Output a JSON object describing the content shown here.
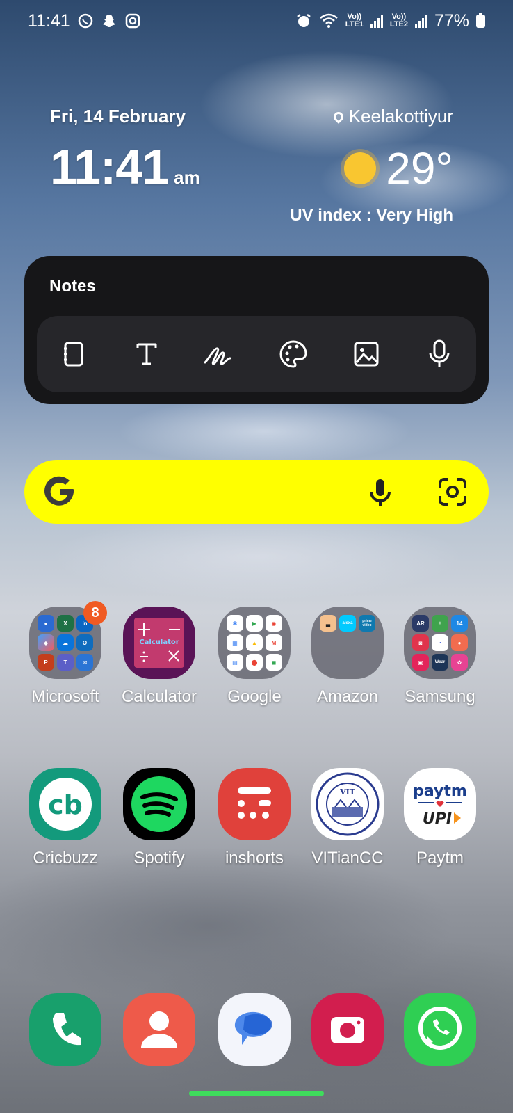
{
  "status_bar": {
    "time": "11:41",
    "left_icons": [
      "whatsapp-icon",
      "snapchat-icon",
      "instagram-icon"
    ],
    "sim1": "VoLTE1",
    "sim2": "VoLTE2",
    "sim1_lines": [
      "Vo))",
      "LTE1"
    ],
    "sim2_lines": [
      "Vo))",
      "LTE2"
    ],
    "battery": "77%"
  },
  "clock_widget": {
    "date": "Fri, 14 February",
    "time": "11:41",
    "ampm": "am",
    "location": "Keelakottiyur",
    "temperature": "29°",
    "uv": "UV index : Very High"
  },
  "notes_widget": {
    "title": "Notes",
    "tools": [
      "notebook-icon",
      "text-icon",
      "handwriting-icon",
      "palette-icon",
      "image-icon",
      "mic-icon"
    ]
  },
  "search": {
    "colors": {
      "bar": "#ffff00"
    }
  },
  "folders": [
    {
      "label": "Microsoft",
      "badge": "8"
    },
    {
      "label": "Calculator",
      "inner": "Calculator"
    },
    {
      "label": "Google"
    },
    {
      "label": "Amazon",
      "inner": [
        "alexa",
        "prime video"
      ]
    },
    {
      "label": "Samsung",
      "inner": [
        "AR",
        "14",
        "Wear"
      ]
    }
  ],
  "apps_row2": [
    {
      "label": "Cricbuzz",
      "glyph": "cb"
    },
    {
      "label": "Spotify"
    },
    {
      "label": "inshorts"
    },
    {
      "label": "VITianCC",
      "glyph": "VIT"
    },
    {
      "label": "Paytm",
      "glyph1": "paytm",
      "glyph2": "UPI"
    }
  ],
  "dock": [
    "phone-icon",
    "contacts-icon",
    "messages-icon",
    "camera-icon",
    "whatsapp-icon"
  ]
}
